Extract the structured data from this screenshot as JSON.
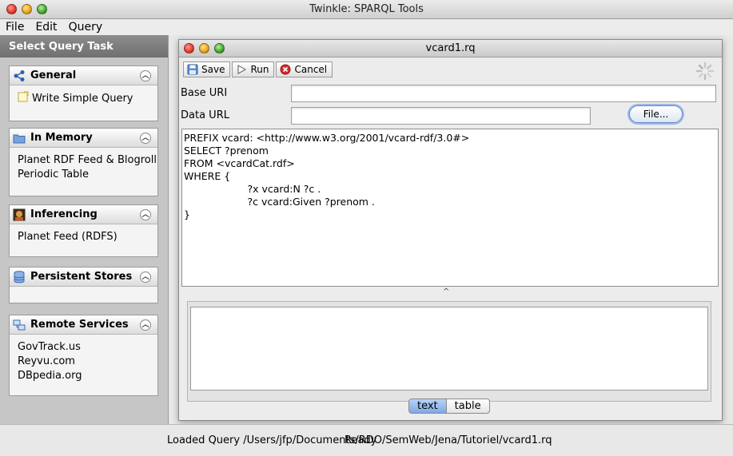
{
  "app": {
    "title": "Twinkle: SPARQL Tools"
  },
  "menu": {
    "items": [
      "File",
      "Edit",
      "Query"
    ]
  },
  "sidebar": {
    "header": "Select Query Task",
    "panels": [
      {
        "title": "General",
        "items": [
          "Write Simple Query"
        ]
      },
      {
        "title": "In Memory",
        "items": [
          "Planet RDF Feed & Blogroll",
          "Periodic Table"
        ]
      },
      {
        "title": "Inferencing",
        "items": [
          "Planet Feed (RDFS)"
        ]
      },
      {
        "title": "Persistent Stores",
        "items": []
      },
      {
        "title": "Remote Services",
        "items": [
          "GovTrack.us",
          "Reyvu.com",
          "DBpedia.org"
        ]
      }
    ]
  },
  "query_window": {
    "title": "vcard1.rq",
    "toolbar": {
      "save": "Save",
      "run": "Run",
      "cancel": "Cancel"
    },
    "base_uri_label": "Base URI",
    "base_uri_value": "",
    "data_url_label": "Data URL",
    "data_url_value": "",
    "file_button": "File...",
    "query_text": "PREFIX vcard: <http://www.w3.org/2001/vcard-rdf/3.0#>\nSELECT ?prenom\nFROM <vcardCat.rdf>\nWHERE {\n                    ?x vcard:N ?c .\n                    ?c vcard:Given ?prenom .\n}",
    "results_text": "",
    "view_tabs": {
      "text": "text",
      "table": "table"
    },
    "active_view": "text"
  },
  "status": {
    "message": "Loaded Query /Users/jfp/Documents/RDO/SemWeb/Jena/Tutoriel/vcard1.rq",
    "state": "Ready"
  },
  "colors": {
    "sidebar_bg": "#c6c6c6",
    "accent": "#7fa9e6"
  }
}
